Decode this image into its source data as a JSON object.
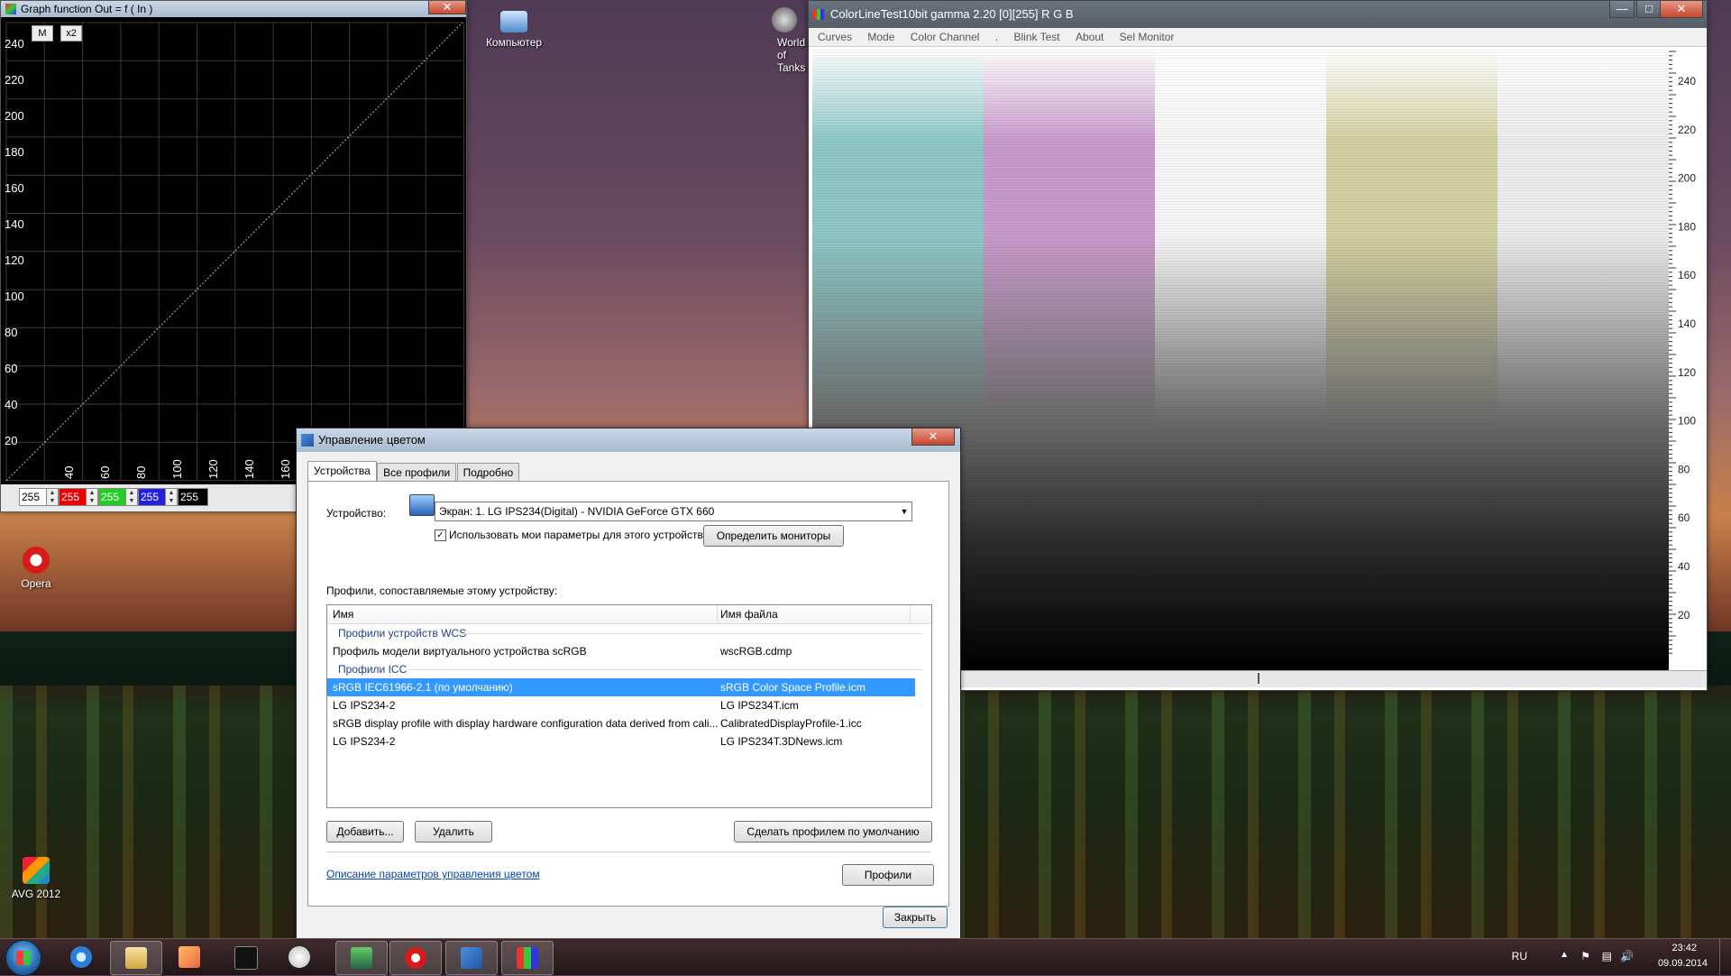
{
  "desktop": {
    "icons": [
      {
        "label": "Компьютер"
      },
      {
        "label": "World of Tanks"
      },
      {
        "label": "Opera"
      },
      {
        "label": "AVG 2012"
      }
    ]
  },
  "graph_window": {
    "title": "Graph function Out = f ( In )",
    "close": "✕",
    "buttons": {
      "m": "M",
      "x2": "x2"
    },
    "y_ticks": [
      "240",
      "220",
      "200",
      "180",
      "160",
      "140",
      "120",
      "100",
      "80",
      "60",
      "40",
      "20"
    ],
    "x_ticks": [
      "40",
      "60",
      "80",
      "100",
      "120",
      "140",
      "160"
    ],
    "spinners": [
      "255",
      "255",
      "255",
      "255",
      "255"
    ]
  },
  "clt_window": {
    "title": "ColorLineTest10bit gamma 2.20 [0][255]   R G B",
    "menu": [
      "Curves",
      "Mode",
      "Color Channel",
      ".",
      "Blink Test",
      "About",
      "Sel Monitor"
    ],
    "ruler_ticks": [
      "240",
      "220",
      "200",
      "180",
      "160",
      "140",
      "120",
      "100",
      "80",
      "60",
      "40",
      "20"
    ],
    "columns": [
      {
        "color": "#8ec8c8"
      },
      {
        "color": "#c89acb"
      },
      {
        "color": "#f6f6f6"
      },
      {
        "color": "#d4d0a2"
      },
      {
        "color": "#ececec"
      }
    ]
  },
  "cm_dialog": {
    "title": "Управление цветом",
    "close": "✕",
    "tabs": [
      "Устройства",
      "Все профили",
      "Подробно"
    ],
    "device_label": "Устройство:",
    "device_value": "Экран: 1. LG IPS234(Digital) - NVIDIA GeForce GTX 660",
    "use_my_settings": "Использовать мои параметры для этого устройства",
    "identify_button": "Определить мониторы",
    "profiles_label": "Профили, сопоставляемые этому устройству:",
    "columns": {
      "name": "Имя",
      "file": "Имя файла"
    },
    "rows": [
      {
        "type": "group",
        "name": "Профили устройств WCS",
        "file": ""
      },
      {
        "type": "item",
        "name": "Профиль модели виртуального устройства scRGB",
        "file": "wscRGB.cdmp"
      },
      {
        "type": "group",
        "name": "Профили ICC",
        "file": ""
      },
      {
        "type": "item",
        "name": "sRGB IEC61966-2.1 (по умолчанию)",
        "file": "sRGB Color Space Profile.icm",
        "selected": true
      },
      {
        "type": "item",
        "name": "LG IPS234-2",
        "file": "LG IPS234T.icm"
      },
      {
        "type": "item",
        "name": "sRGB display profile with display hardware configuration data derived from cali...",
        "file": "CalibratedDisplayProfile-1.icc"
      },
      {
        "type": "item",
        "name": "LG IPS234-2",
        "file": "LG IPS234T.3DNews.icm"
      }
    ],
    "add_button": "Добавить...",
    "remove_button": "Удалить",
    "set_default_button": "Сделать профилем по умолчанию",
    "link": "Описание параметров управления цветом",
    "profiles_button": "Профили",
    "close_button": "Закрыть"
  },
  "taskbar": {
    "language": "RU",
    "time": "23:42",
    "date": "09.09.2014"
  }
}
